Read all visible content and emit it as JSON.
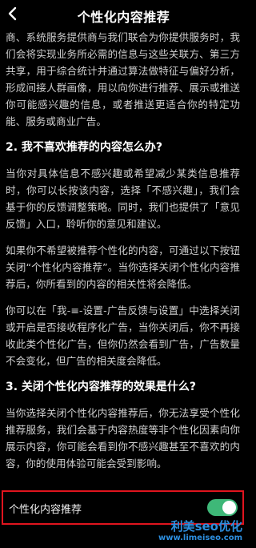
{
  "header": {
    "title": "个性化内容推荐",
    "back_icon": "chevron-left-icon"
  },
  "content": {
    "intro": "商、系统服务提供商与我们联合为你提供服务时，我们会将实现业务所必需的信息与这些关联方、第三方共享，用于综合统计并通过算法做特征与偏好分析，形成间接人群画像，用以向你进行推荐、展示或推送你可能感兴趣的信息，或者推送更适合你的特定功能、服务或商业广告。",
    "section2_heading": "2. 我不喜欢推荐的内容怎么办?",
    "section2_p1": "当你对具体信息不感兴趣或希望减少某类信息推荐时，你可以长按该内容，选择「不感兴趣」，我们会基于你的反馈调整策略。同时，我们也提供了「意见反馈」入口，聆听你的意见和建议。",
    "section2_p2": "如果你不希望被推荐个性化的内容，可通过以下按钮关闭“个性化内容推荐”。当你选择关闭个性化内容推荐后，你所看到的内容的相关性将会降低。",
    "section2_p3": "你可以在「我-≡-设置-广告反馈与设置」中选择关闭或开启是否接收程序化广告，当你关闭后，你不再接收此类个性化广告，但你仍然会看到广告，广告数量不会变化，但广告的相关度会降低。",
    "section3_heading": "3. 关闭个性化内容推荐的效果是什么?",
    "section3_p1": "当你选择关闭个性化内容推荐后，你无法享受个性化推荐服务，我们会基于内容热度等非个性化因素向你展示内容，你可能会看到你不感兴趣甚至不喜欢的内容，你的使用体验可能会受到影响。"
  },
  "toggle": {
    "label": "个性化内容推荐",
    "state": "on",
    "on_color": "#3eb878",
    "highlight_border_color": "#e0141e"
  },
  "watermark": {
    "main": "利美seo优化",
    "url": "www.limeiseo.com"
  }
}
